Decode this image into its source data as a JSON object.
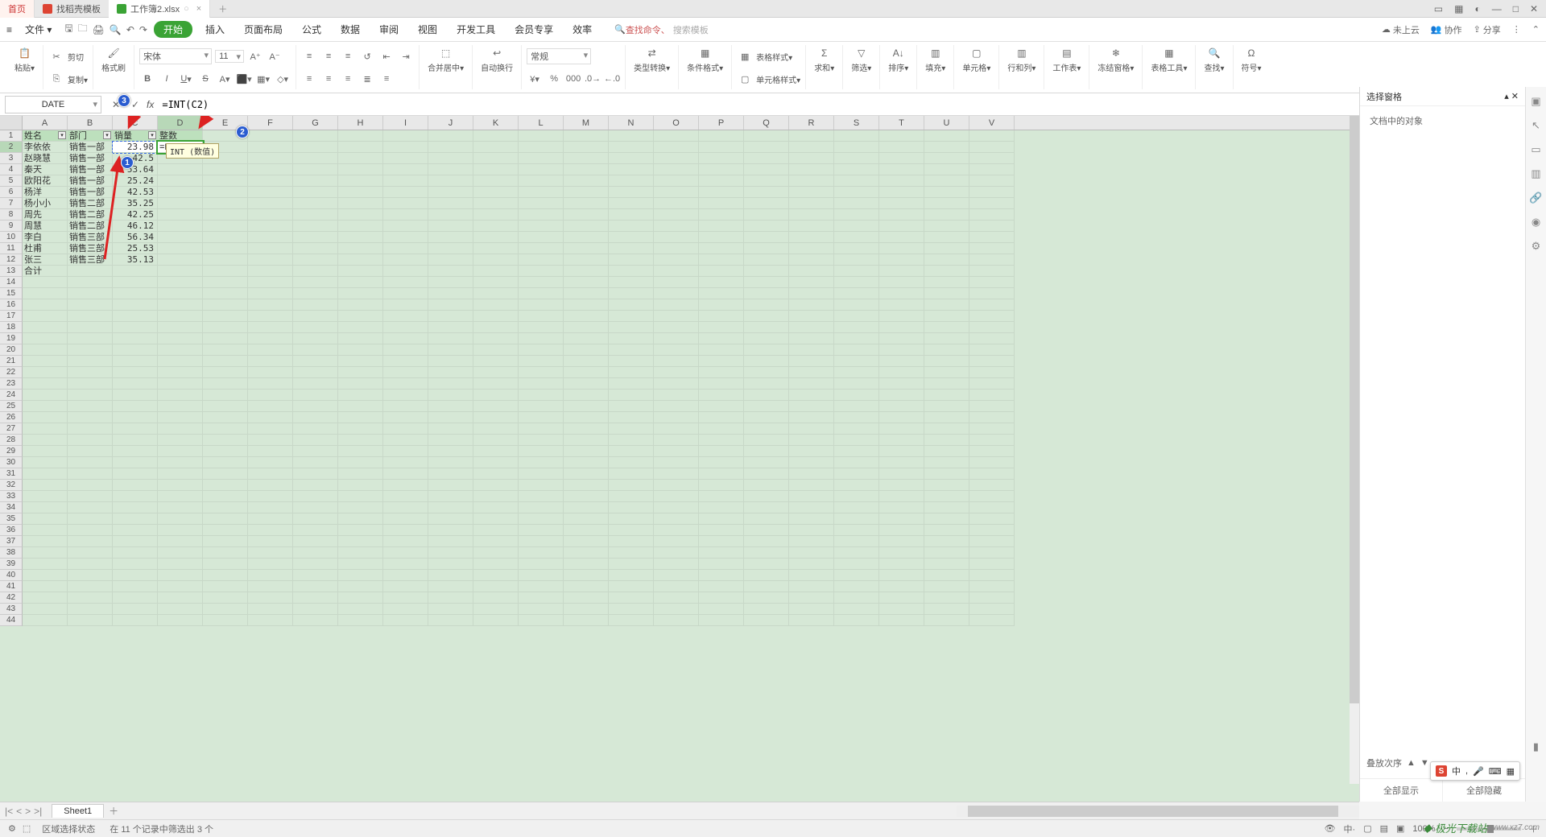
{
  "window": {
    "tab_home": "首页",
    "tab_template": "找稻壳模板",
    "tab_doc": "工作簿2.xlsx"
  },
  "menu": {
    "file": "文件",
    "items": [
      "开始",
      "插入",
      "页面布局",
      "公式",
      "数据",
      "审阅",
      "视图",
      "开发工具",
      "会员专享",
      "效率"
    ],
    "search_hint": "查找命令、",
    "search_ph": "搜索模板",
    "cloud": "未上云",
    "coop": "协作",
    "share": "分享"
  },
  "ribbon": {
    "paste": "粘贴",
    "cut": "剪切",
    "copy": "复制",
    "format_painter": "格式刷",
    "font_name": "宋体",
    "font_size": "11",
    "merge": "合并居中",
    "wrap": "自动换行",
    "number_fmt": "常规",
    "type_convert": "类型转换",
    "cond_fmt": "条件格式",
    "table_style": "表格样式",
    "cell_style": "单元格样式",
    "sum": "求和",
    "filter": "筛选",
    "sort": "排序",
    "fill": "填充",
    "cell": "单元格",
    "rowcol": "行和列",
    "worksheet": "工作表",
    "freeze": "冻结窗格",
    "table_tools": "表格工具",
    "find": "查找",
    "symbol": "符号"
  },
  "fx": {
    "namebox": "DATE",
    "formula": "=INT(C2)",
    "formula_prefix": "=INT(",
    "formula_arg": "C2",
    "formula_suffix": ")",
    "tooltip_text": "INT (数值)"
  },
  "cols": [
    "A",
    "B",
    "C",
    "D",
    "E",
    "F",
    "G",
    "H",
    "I",
    "J",
    "K",
    "L",
    "M",
    "N",
    "O",
    "P",
    "Q",
    "R",
    "S",
    "T",
    "U",
    "V"
  ],
  "headers": {
    "A": "姓名",
    "B": "部门",
    "C": "销量",
    "D": "整数"
  },
  "data_rows": [
    {
      "n": 2,
      "A": "李依依",
      "B": "销售一部",
      "C": "23.98"
    },
    {
      "n": 3,
      "A": "赵晓慧",
      "B": "销售一部",
      "C": "42.5"
    },
    {
      "n": 4,
      "A": "秦天",
      "B": "销售一部",
      "C": "53.64"
    },
    {
      "n": 5,
      "A": "欧阳花",
      "B": "销售一部",
      "C": "25.24"
    },
    {
      "n": 6,
      "A": "杨洋",
      "B": "销售一部",
      "C": "42.53"
    },
    {
      "n": 7,
      "A": "杨小小",
      "B": "销售二部",
      "C": "35.25"
    },
    {
      "n": 8,
      "A": "周先",
      "B": "销售二部",
      "C": "42.25"
    },
    {
      "n": 9,
      "A": "周慧",
      "B": "销售二部",
      "C": "46.12"
    },
    {
      "n": 10,
      "A": "李白",
      "B": "销售三部",
      "C": "56.34"
    },
    {
      "n": 11,
      "A": "杜甫",
      "B": "销售三部",
      "C": "25.53"
    },
    {
      "n": 12,
      "A": "张三",
      "B": "销售三部",
      "C": "35.13"
    },
    {
      "n": 13,
      "A": "合计",
      "B": "",
      "C": ""
    }
  ],
  "taskpane": {
    "title": "选择窗格",
    "subtitle": "文档中的对象",
    "show_all": "全部显示",
    "hide_all": "全部隐藏",
    "stacking": "叠放次序"
  },
  "ime": {
    "lang": "中",
    "punct": ","
  },
  "sheets": {
    "name": "Sheet1"
  },
  "status": {
    "mode": "区域选择状态",
    "filter_info": "在 11 个记录中筛选出 3 个",
    "zoom": "100%"
  },
  "watermark": {
    "text": "极光下载站",
    "url": "www.xz7.com"
  }
}
